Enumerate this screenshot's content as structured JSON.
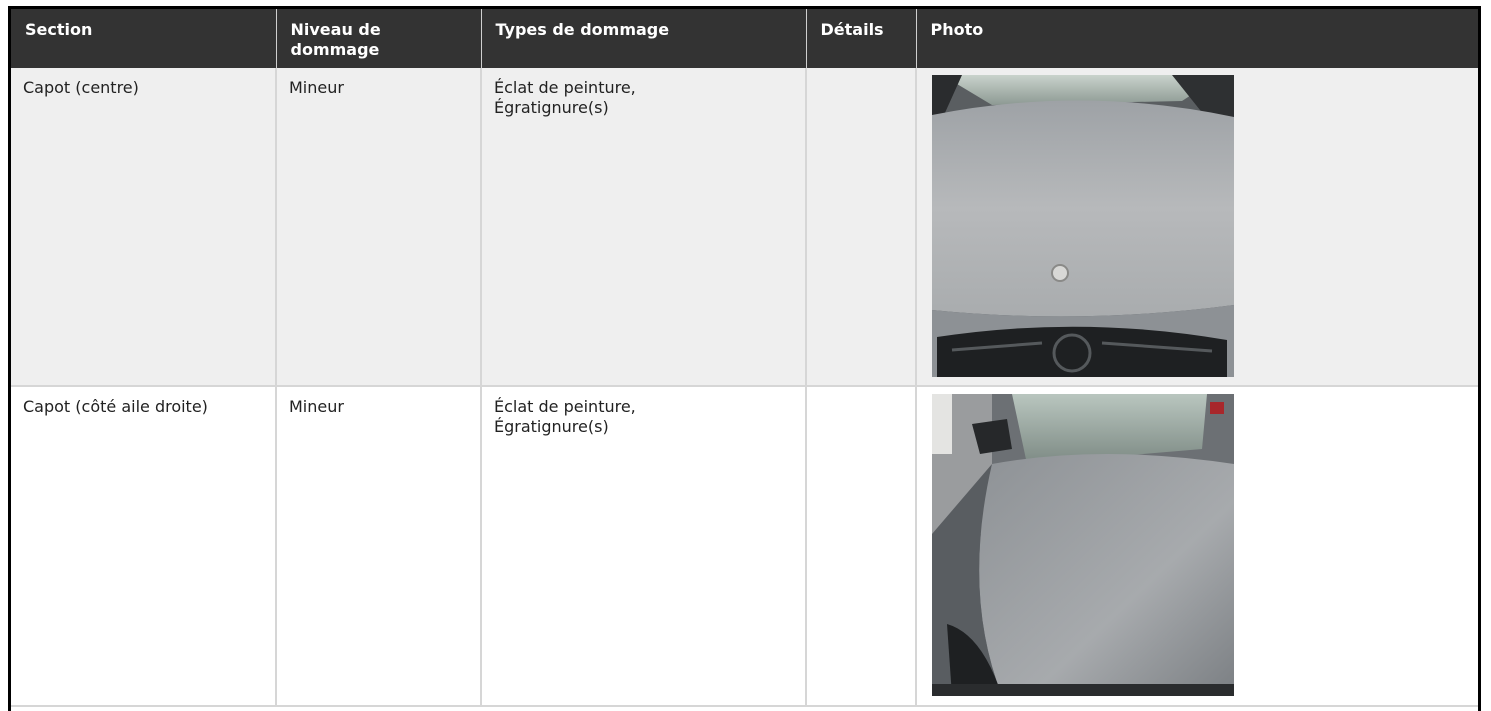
{
  "table": {
    "headers": {
      "section": "Section",
      "niveau": "Niveau de dommage",
      "types": "Types de dommage",
      "details": "Détails",
      "photo": "Photo"
    },
    "rows": [
      {
        "section": "Capot (centre)",
        "niveau": "Mineur",
        "types_line1": "Éclat de peinture,",
        "types_line2": "Égratignure(s)",
        "details": "",
        "photo_subject": "silver car hood front view with emblem"
      },
      {
        "section": "Capot (côté aile droite)",
        "niveau": "Mineur",
        "types_line1": "Éclat de peinture,",
        "types_line2": "Égratignure(s)",
        "details": "",
        "photo_subject": "silver car hood right side view"
      }
    ]
  }
}
